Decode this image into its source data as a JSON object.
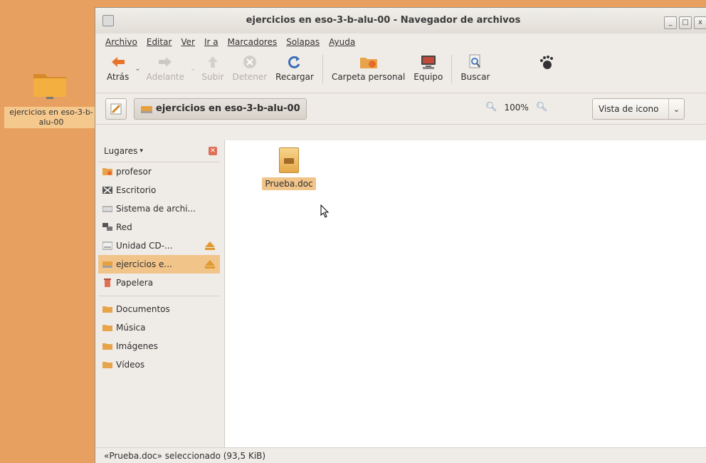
{
  "desktop": {
    "icon_label": "ejercicios en eso-3-b-alu-00"
  },
  "window": {
    "title": "ejercicios en eso-3-b-alu-00 - Navegador de archivos",
    "buttons": {
      "minimize": "_",
      "maximize": "□",
      "close": "x"
    }
  },
  "menubar": {
    "items": [
      "Archivo",
      "Editar",
      "Ver",
      "Ir a",
      "Marcadores",
      "Solapas",
      "Ayuda"
    ]
  },
  "toolbar": {
    "back": "Atrás",
    "forward": "Adelante",
    "up": "Subir",
    "stop": "Detener",
    "reload": "Recargar",
    "home": "Carpeta personal",
    "computer": "Equipo",
    "search": "Buscar"
  },
  "location": {
    "path": "ejercicios en eso-3-b-alu-00",
    "zoom": "100%",
    "view": "Vista de icono"
  },
  "sidebar": {
    "header": "Lugares",
    "items": [
      {
        "label": "profesor"
      },
      {
        "label": "Escritorio"
      },
      {
        "label": "Sistema de archi..."
      },
      {
        "label": "Red"
      },
      {
        "label": "Unidad CD-..."
      },
      {
        "label": "ejercicios e..."
      },
      {
        "label": "Papelera"
      }
    ],
    "bookmarks": [
      {
        "label": "Documentos"
      },
      {
        "label": "Música"
      },
      {
        "label": "Imágenes"
      },
      {
        "label": "Vídeos"
      }
    ]
  },
  "files": [
    {
      "name": "Prueba.doc"
    }
  ],
  "status": "«Prueba.doc» seleccionado (93,5 KiB)",
  "colors": {
    "desktop": "#e8a060",
    "selection": "#f1c48a",
    "window_bg": "#efebe7"
  }
}
